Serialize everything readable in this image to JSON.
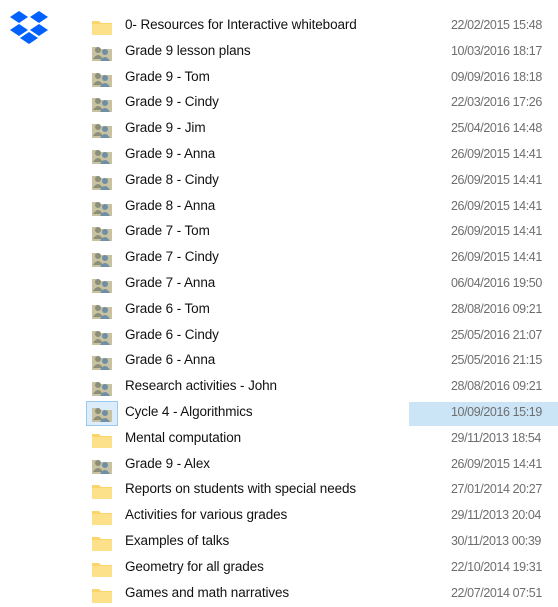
{
  "app": {
    "logo_icon": "dropbox-icon"
  },
  "colors": {
    "folder": "#fbd46b",
    "shared_folder": "#8a8f7c",
    "selection": "#cce5f6",
    "brand": "#0061fe"
  },
  "files": [
    {
      "name": "0- Resources for Interactive whiteboard",
      "date": "22/02/2015 15:48",
      "icon": "folder-icon"
    },
    {
      "name": "Grade 9 lesson plans",
      "date": "10/03/2016 18:17",
      "icon": "shared-folder-icon"
    },
    {
      "name": "Grade 9 - Tom",
      "date": "09/09/2016 18:18",
      "icon": "shared-folder-icon"
    },
    {
      "name": "Grade 9 - Cindy",
      "date": "22/03/2016 17:26",
      "icon": "shared-folder-icon"
    },
    {
      "name": "Grade 9 - Jim",
      "date": "25/04/2016 14:48",
      "icon": "shared-folder-icon"
    },
    {
      "name": "Grade 9 - Anna",
      "date": "26/09/2015 14:41",
      "icon": "shared-folder-icon"
    },
    {
      "name": "Grade 8 - Cindy",
      "date": "26/09/2015 14:41",
      "icon": "shared-folder-icon"
    },
    {
      "name": "Grade 8 - Anna",
      "date": "26/09/2015 14:41",
      "icon": "shared-folder-icon"
    },
    {
      "name": "Grade 7 - Tom",
      "date": "26/09/2015 14:41",
      "icon": "shared-folder-icon"
    },
    {
      "name": "Grade 7 - Cindy",
      "date": "26/09/2015 14:41",
      "icon": "shared-folder-icon"
    },
    {
      "name": "Grade 7 - Anna",
      "date": "06/04/2016 19:50",
      "icon": "shared-folder-icon"
    },
    {
      "name": "Grade 6 - Tom",
      "date": "28/08/2016 09:21",
      "icon": "shared-folder-icon"
    },
    {
      "name": "Grade 6 - Cindy",
      "date": "25/05/2016 21:07",
      "icon": "shared-folder-icon"
    },
    {
      "name": "Grade 6 - Anna",
      "date": "25/05/2016 21:15",
      "icon": "shared-folder-icon"
    },
    {
      "name": "Research activities - John",
      "date": "28/08/2016 09:21",
      "icon": "shared-folder-icon"
    },
    {
      "name": "Cycle 4 - Algorithmics",
      "date": "10/09/2016 15:19",
      "icon": "shared-folder-icon",
      "selected": true
    },
    {
      "name": "Mental computation",
      "date": "29/11/2013 18:54",
      "icon": "folder-icon"
    },
    {
      "name": "Grade 9 - Alex",
      "date": "26/09/2015 14:41",
      "icon": "shared-folder-icon"
    },
    {
      "name": "Reports on students with special needs",
      "date": "27/01/2014 20:27",
      "icon": "folder-icon"
    },
    {
      "name": "Activities for various grades",
      "date": "29/11/2013 20:04",
      "icon": "folder-icon"
    },
    {
      "name": "Examples of talks",
      "date": "30/11/2013 00:39",
      "icon": "folder-icon"
    },
    {
      "name": "Geometry for all grades",
      "date": "22/10/2014 19:31",
      "icon": "folder-icon"
    },
    {
      "name": "Games and math narratives",
      "date": "22/07/2014 07:51",
      "icon": "folder-icon"
    }
  ]
}
